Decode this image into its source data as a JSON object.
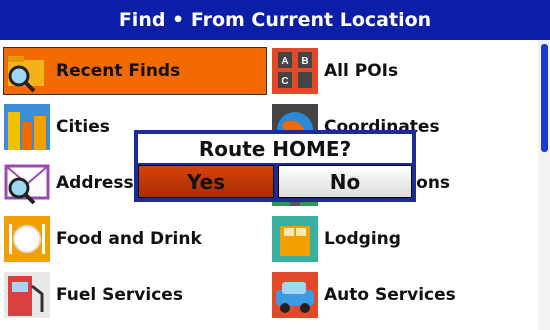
{
  "title": "Find • From Current Location",
  "menu": {
    "left": [
      {
        "label": "Recent Finds",
        "icon": "recent-finds-icon",
        "selected": true
      },
      {
        "label": "Cities",
        "icon": "cities-icon"
      },
      {
        "label": "Addresses",
        "icon": "addresses-icon"
      },
      {
        "label": "Food and Drink",
        "icon": "food-and-drink-icon"
      },
      {
        "label": "Fuel Services",
        "icon": "fuel-services-icon"
      }
    ],
    "right": [
      {
        "label": "All POIs",
        "icon": "all-pois-icon"
      },
      {
        "label": "Coordinates",
        "icon": "coordinates-icon"
      },
      {
        "label": "Intersections",
        "icon": "intersections-icon"
      },
      {
        "label": "Lodging",
        "icon": "lodging-icon"
      },
      {
        "label": "Auto Services",
        "icon": "auto-services-icon"
      }
    ]
  },
  "dialog": {
    "question": "Route HOME?",
    "yes_label": "Yes",
    "no_label": "No"
  },
  "colors": {
    "title_bar": "#0a1ea8",
    "selected": "#f26a00",
    "dialog_border": "#1c2a9a",
    "yes_button": "#c03a06",
    "scrollbar": "#1a3ad8"
  }
}
